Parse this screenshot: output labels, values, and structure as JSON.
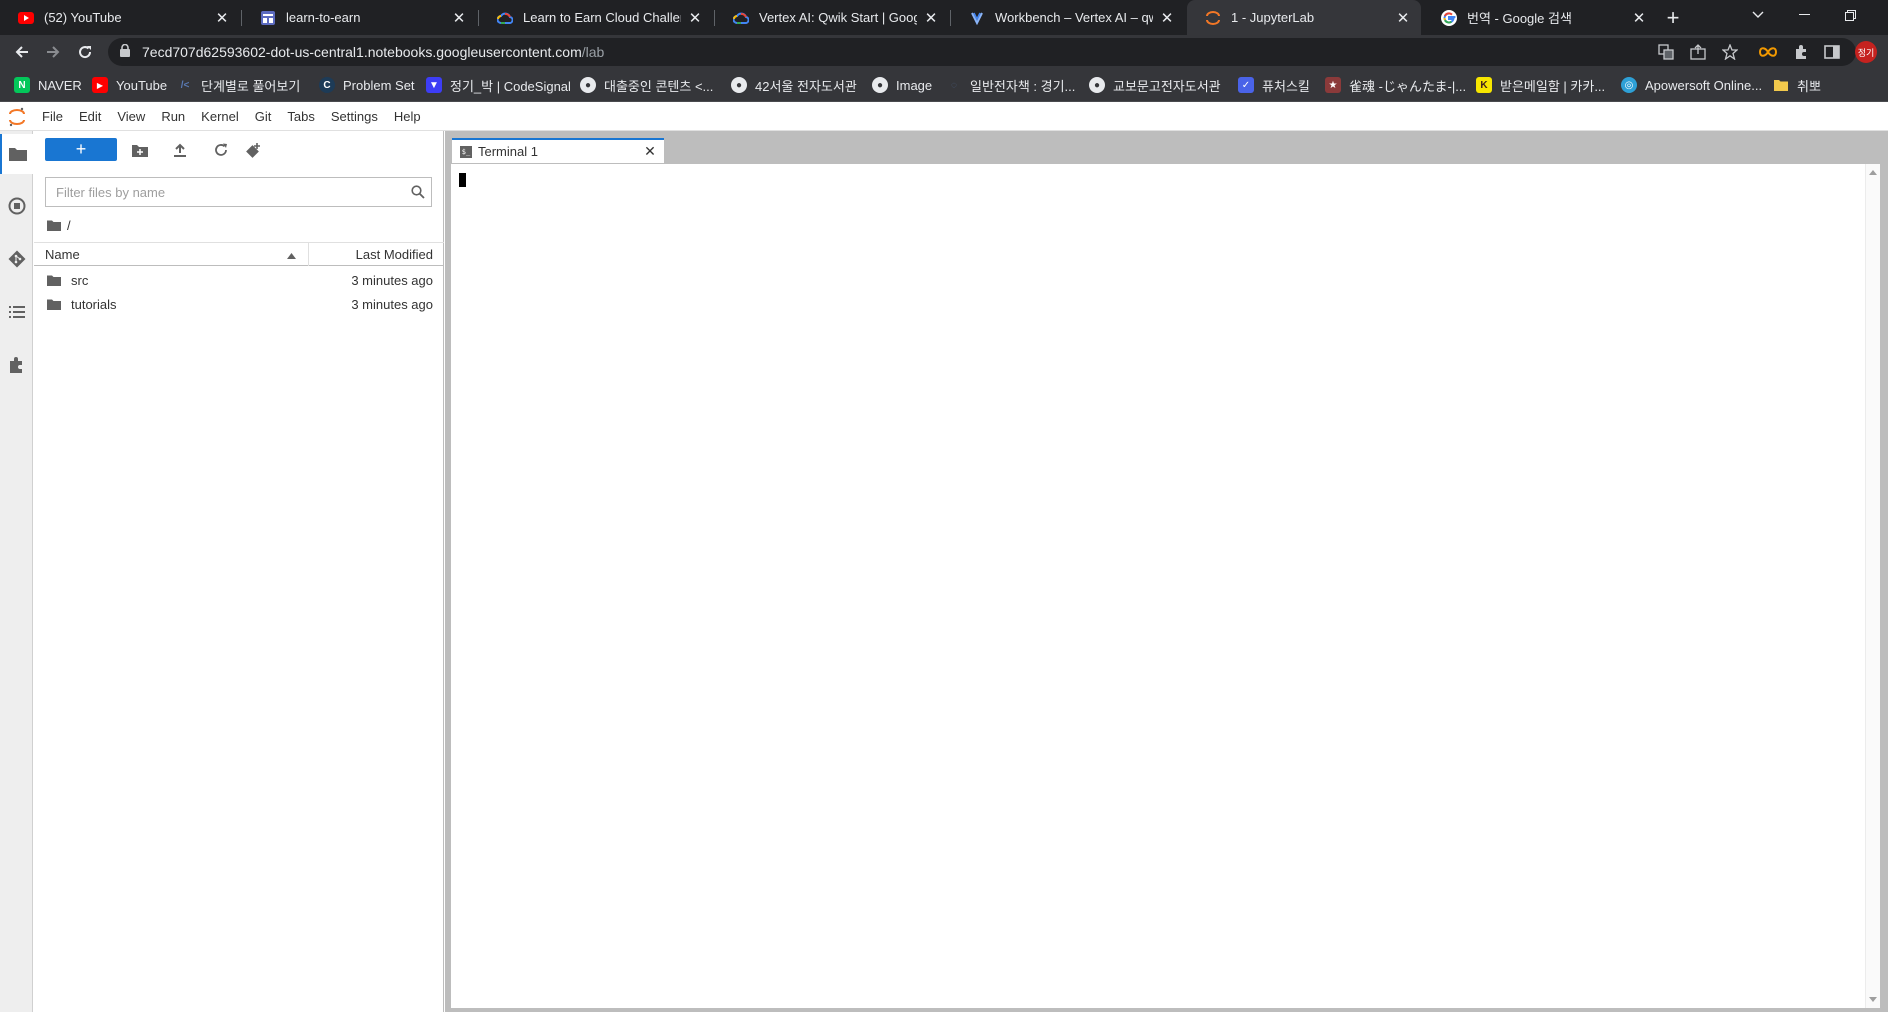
{
  "browser": {
    "tabs": [
      {
        "title": "(52) YouTube",
        "favicon": "youtube-icon"
      },
      {
        "title": "learn-to-earn",
        "favicon": "page-icon"
      },
      {
        "title": "Learn to Earn Cloud Challenge",
        "favicon": "google-cloud-icon"
      },
      {
        "title": "Vertex AI: Qwik Start | Google C",
        "favicon": "google-cloud-icon"
      },
      {
        "title": "Workbench – Vertex AI – qwikl",
        "favicon": "vertex-icon"
      },
      {
        "title": "1 - JupyterLab",
        "favicon": "jupyter-icon",
        "active": true
      },
      {
        "title": "번역 - Google 검색",
        "favicon": "google-icon"
      }
    ],
    "url_host": "7ecd707d62593602-dot-us-central1.notebooks.googleusercontent.com",
    "url_path": "/lab",
    "profile_label": "정기",
    "bookmarks": [
      {
        "label": "NAVER",
        "color": "#03c75a",
        "glyph": "N"
      },
      {
        "label": "YouTube",
        "color": "#ff0000",
        "glyph": "▶"
      },
      {
        "label": "단계별로 풀어보기",
        "color": "#1f2d3d",
        "glyph": "/<"
      },
      {
        "label": "Problem Set",
        "color": "#1d3b57",
        "glyph": "C"
      },
      {
        "label": "정기_박 | CodeSignal",
        "color": "#3d3df5",
        "glyph": "▼"
      },
      {
        "label": "대출중인 콘텐츠 <...",
        "color": "#5f6368",
        "glyph": "◉"
      },
      {
        "label": "42서울 전자도서관",
        "color": "#5f6368",
        "glyph": "◉"
      },
      {
        "label": "Image",
        "color": "#5f6368",
        "glyph": "◉"
      },
      {
        "label": "일반전자책 : 경기...",
        "color": "#1f2d3d",
        "glyph": "◌"
      },
      {
        "label": "교보문고전자도서관",
        "color": "#5f6368",
        "glyph": "◉"
      },
      {
        "label": "퓨처스킬",
        "color": "#4a63e8",
        "glyph": "✓"
      },
      {
        "label": "雀魂 -じゃんたま-|...",
        "color": "#8b3a3a",
        "glyph": "★"
      },
      {
        "label": "받은메일함 | 카카...",
        "color": "#f7e600",
        "glyph": "K"
      },
      {
        "label": "Apowersoft Online...",
        "color": "#2ea0d6",
        "glyph": "◎"
      },
      {
        "label": "취뽀",
        "color": "#f2c94c",
        "glyph": ""
      }
    ]
  },
  "jupyter": {
    "menus": [
      "File",
      "Edit",
      "View",
      "Run",
      "Kernel",
      "Git",
      "Tabs",
      "Settings",
      "Help"
    ],
    "filter_placeholder": "Filter files by name",
    "breadcrumb": "/",
    "columns": {
      "name": "Name",
      "modified": "Last Modified"
    },
    "files": [
      {
        "name": "src",
        "modified": "3 minutes ago"
      },
      {
        "name": "tutorials",
        "modified": "3 minutes ago"
      }
    ],
    "doc_tab": {
      "label": "Terminal 1",
      "icon_text": "$_"
    },
    "accent": "#1976d2"
  }
}
